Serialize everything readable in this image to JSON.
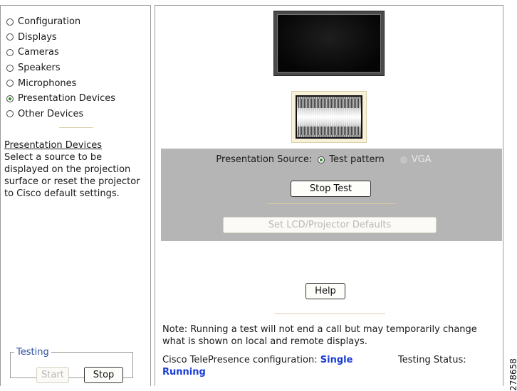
{
  "sidebar": {
    "items": [
      {
        "label": "Configuration",
        "selected": false
      },
      {
        "label": "Displays",
        "selected": false
      },
      {
        "label": "Cameras",
        "selected": false
      },
      {
        "label": "Speakers",
        "selected": false
      },
      {
        "label": "Microphones",
        "selected": false
      },
      {
        "label": "Presentation Devices",
        "selected": true
      },
      {
        "label": "Other Devices",
        "selected": false
      }
    ],
    "description_title": "Presentation Devices",
    "description_text": "Select a source to be displayed on the projection surface or reset the projector to Cisco default settings."
  },
  "testing": {
    "legend": "Testing",
    "start_label": "Start",
    "stop_label": "Stop"
  },
  "main": {
    "source_label": "Presentation Source:",
    "options": [
      {
        "label": "Test pattern",
        "selected": true,
        "enabled": true
      },
      {
        "label": "VGA",
        "selected": false,
        "enabled": false
      }
    ],
    "stop_test_label": "Stop Test",
    "defaults_label": "Set LCD/Projector Defaults",
    "help_label": "Help",
    "note": "Note: Running a test will not end a call but may temporarily change what is shown on local and remote displays.",
    "config_label": "Cisco TelePresence configuration:",
    "config_value": "Single",
    "status_label": "Testing Status:",
    "status_value": "Running"
  },
  "figure_number": "278658",
  "colors": {
    "accent_blue": "#1a3cd4",
    "legend_blue": "#2a4fa0",
    "source_panel": "#b5b5b5",
    "selected_radio": "#2a8a2a"
  }
}
